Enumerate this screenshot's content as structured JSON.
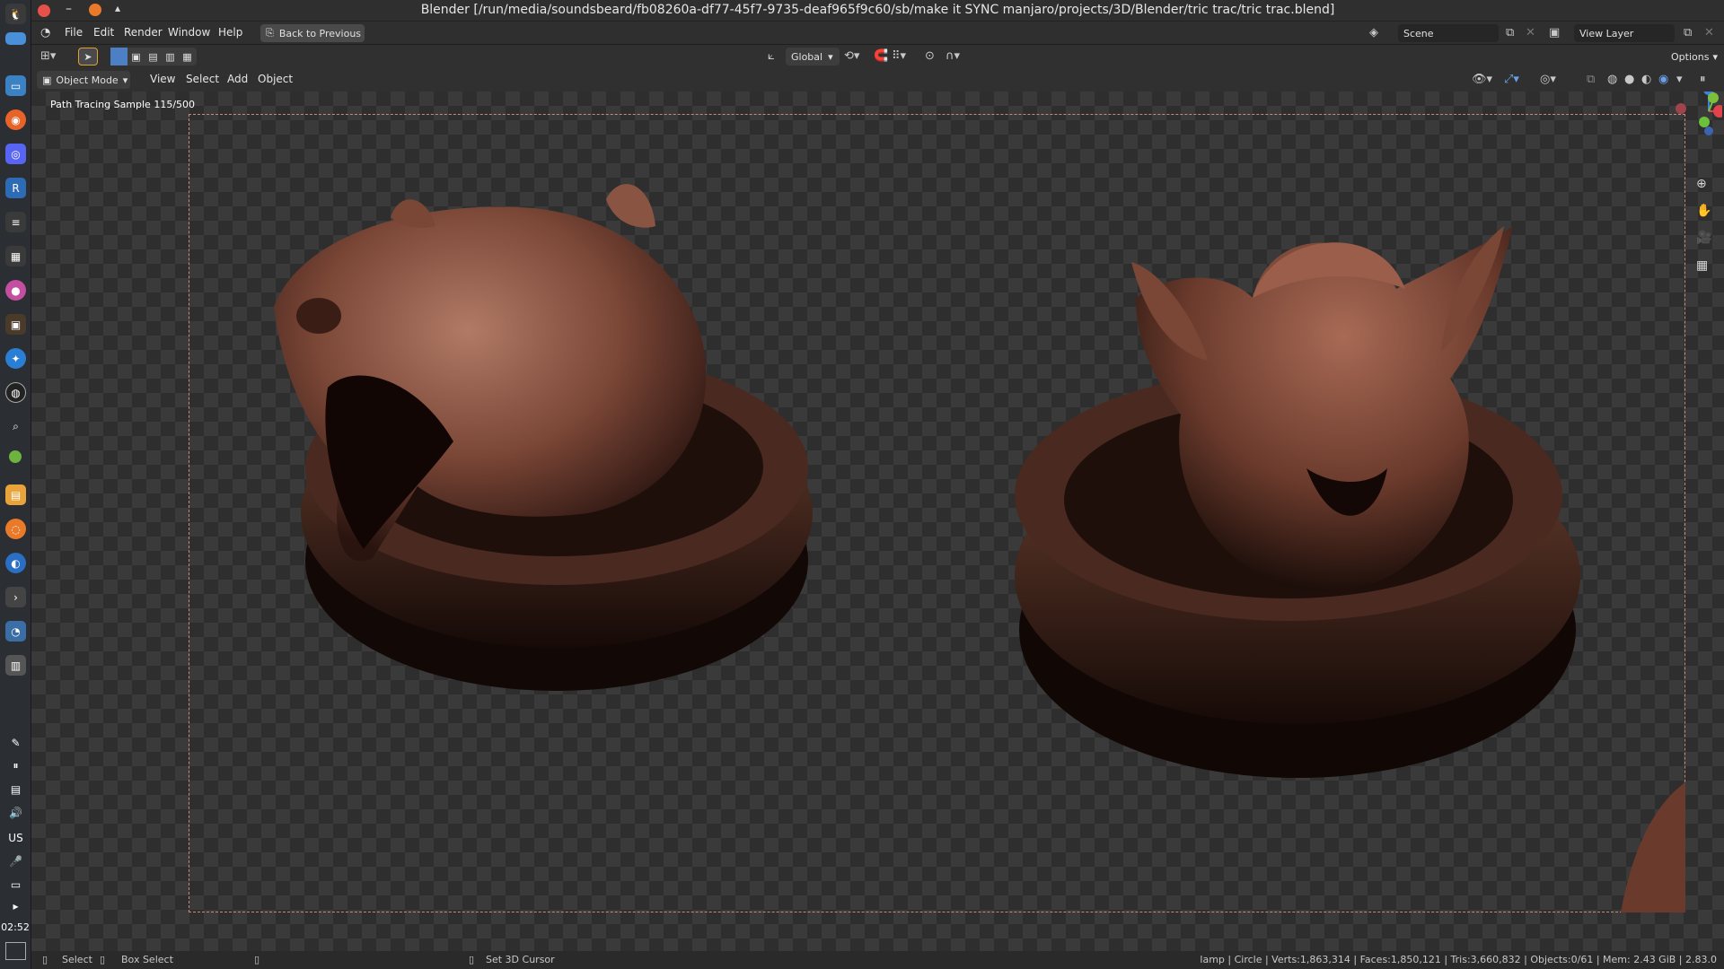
{
  "window": {
    "title": "Blender [/run/media/soundsbeard/fb08260a-df77-45f7-9735-deaf965f9c60/sb/make it SYNC manjaro/projects/3D/Blender/tric trac/tric trac.blend]"
  },
  "menubar": {
    "items": [
      "File",
      "Edit",
      "Render",
      "Window",
      "Help"
    ],
    "back_button": "Back to Previous",
    "scene_label": "Scene",
    "view_layer_label": "View Layer"
  },
  "tool_header": {
    "orientation": "Global",
    "options_label": "Options"
  },
  "viewport_header": {
    "mode": "Object Mode",
    "menus": [
      "View",
      "Select",
      "Add",
      "Object"
    ]
  },
  "viewport": {
    "render_status": "Path Tracing Sample 115/500"
  },
  "taskbar": {
    "keyboard_layout": "US",
    "clock": "02:52"
  },
  "statusbar": {
    "select": "Select",
    "box_select": "Box Select",
    "set_cursor": "Set 3D Cursor",
    "stats": "lamp | Circle | Verts:1,863,314 | Faces:1,850,121 | Tris:3,660,832 | Objects:0/61 | Mem: 2.43 GiB | 2.83.0"
  },
  "colors": {
    "axis_x": "#e0434b",
    "axis_y": "#7cbf3b",
    "axis_z": "#3b83e0",
    "wood": "#8a5443"
  }
}
